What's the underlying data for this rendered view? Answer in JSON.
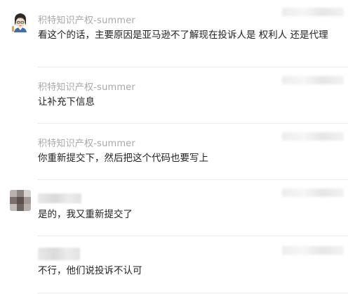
{
  "comments": [
    {
      "author": "积特知识产权-summer",
      "text": "看这个的话，主要原因是亚马逊不了解现在投诉人是 权利人 还是代理"
    },
    {
      "author": "积特知识产权-summer",
      "text": "让补充下信息"
    },
    {
      "author": "积特知识产权-summer",
      "text": "你重新提交下，然后把这个代码也要写上"
    },
    {
      "author": "",
      "text": "是的，我又重新提交了"
    },
    {
      "author": "",
      "text": "不行，他们说投诉不认可"
    }
  ],
  "icons": {
    "agent_avatar": "cartoon-girl-avatar",
    "user_avatar": "blurred-photo-avatar"
  }
}
